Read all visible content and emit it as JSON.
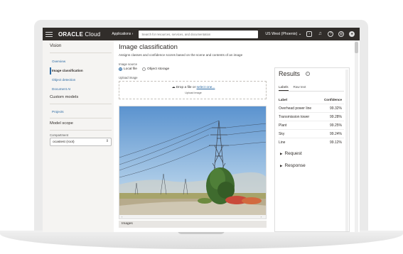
{
  "topbar": {
    "logo_brand": "ORACLE",
    "logo_product": "Cloud",
    "applications": "Applications ›",
    "search_placeholder": "Search for resources, services, and documentation",
    "region": "US West (Phoenix) ⌄"
  },
  "sidebar": {
    "heading": "Vision",
    "items": [
      {
        "label": "Overview"
      },
      {
        "label": "Image classification"
      },
      {
        "label": "Object detection"
      },
      {
        "label": "Document AI"
      }
    ],
    "custom_models_heading": "Custom models",
    "projects": "Projects",
    "model_scope_heading": "Model scope",
    "compartment_label": "Compartment",
    "compartment_value": "ocastest (root)"
  },
  "main": {
    "title": "Image classification",
    "subtitle": "Assigns classes and confidence scores based on the scene and contents of an image",
    "image_source_label": "Image source",
    "source_options": [
      {
        "label": "Local file",
        "selected": true
      },
      {
        "label": "Object storage",
        "selected": false
      }
    ],
    "upload_label": "Upload image",
    "drop_text": "Drop a file or",
    "drop_link": "select one...",
    "drop_sub": "Upload image",
    "images_tab": "Images"
  },
  "results": {
    "title": "Results",
    "tabs": [
      "Labels",
      "Raw text"
    ],
    "columns": [
      "Label",
      "Confidence"
    ],
    "rows": [
      {
        "label": "Overhead power line",
        "confidence": "99.32%"
      },
      {
        "label": "Transmission tower",
        "confidence": "99.28%"
      },
      {
        "label": "Plant",
        "confidence": "99.25%"
      },
      {
        "label": "Sky",
        "confidence": "99.24%"
      },
      {
        "label": "Line",
        "confidence": "99.12%"
      }
    ],
    "request": "Request",
    "response": "Response"
  },
  "colors": {
    "topbar": "#312d2a",
    "link": "#2c6aa3",
    "sidebar_bg": "#f5f4f2"
  }
}
